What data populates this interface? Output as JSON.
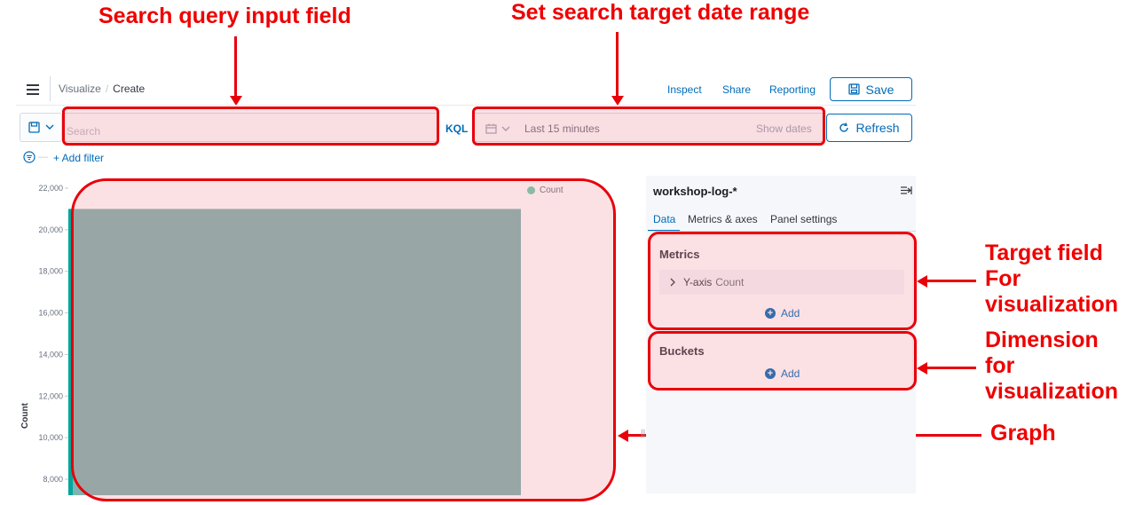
{
  "annotations": {
    "search_query": "Search query input field",
    "date_range": "Set search target date range",
    "target_field": [
      "Target field",
      "For",
      "visualization"
    ],
    "dimension": [
      "Dimension",
      "for",
      "visualization"
    ],
    "graph": "Graph"
  },
  "header": {
    "breadcrumb_parent": "Visualize",
    "breadcrumb_separator": "/",
    "breadcrumb_current": "Create",
    "inspect": "Inspect",
    "share": "Share",
    "reporting": "Reporting",
    "save": "Save"
  },
  "querybar": {
    "search_placeholder": "Search",
    "language": "KQL",
    "date_range": "Last 15 minutes",
    "show_dates": "Show dates",
    "refresh": "Refresh"
  },
  "filters": {
    "dash": "—",
    "add_filter": "+ Add filter"
  },
  "chart_data": {
    "type": "bar",
    "ylabel": "Count",
    "legend": [
      "Count"
    ],
    "legend_position": "top-right",
    "yticks": [
      "22,000",
      "20,000",
      "18,000",
      "16,000",
      "14,000",
      "12,000",
      "10,000",
      "8,000"
    ],
    "ylim": [
      8000,
      22000
    ],
    "series": [
      {
        "name": "Count",
        "values": [
          21000
        ]
      }
    ],
    "colors": {
      "bar": "#7fb5b0",
      "bar_edge": "#00a69b",
      "legend": "#6dccb1"
    }
  },
  "panel": {
    "index_pattern": "workshop-log-*",
    "tabs": [
      "Data",
      "Metrics & axes",
      "Panel settings"
    ],
    "metrics_title": "Metrics",
    "metric_axis": "Y-axis",
    "metric_agg": "Count",
    "metrics_add": "Add",
    "buckets_title": "Buckets",
    "buckets_add": "Add"
  }
}
